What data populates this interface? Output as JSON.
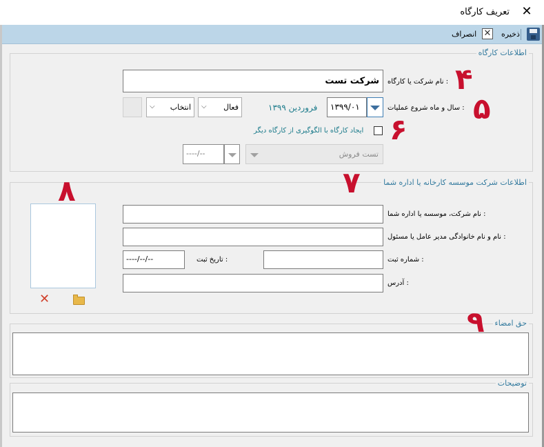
{
  "window": {
    "title": "تعریف کارگاه",
    "close_glyph": "✕"
  },
  "toolbar": {
    "save_label": "ذخیره",
    "cancel_label": "انصراف",
    "cancel_glyph": "✕"
  },
  "workshop_info": {
    "legend": "اطلاعات کارگاه",
    "company_label": "نام شرکت یا کارگاه :",
    "company_value": "شرکت تست",
    "start_label": "سال و ماه شروع عملیات :",
    "start_value": "۱۳۹۹/۰۱",
    "start_display": "فروردین ۱۳۹۹",
    "status_value": "فعال",
    "select_value": "انتخاب",
    "pattern_label": "ایجاد کارگاه با الگوگیری از کارگاه دیگر",
    "source_workshop_value": "تست فروش",
    "source_date_value": "----/--"
  },
  "company_info": {
    "legend": "اطلاعات شرکت موسسه کارخانه یا اداره شما",
    "name_label": "نام شرکت، موسسه یا اداره شما :",
    "manager_label": "نام و نام خانوادگی مدیر عامل یا مسئول :",
    "reg_number_label": "شماره ثبت :",
    "reg_date_label": "تاریخ ثبت :",
    "reg_date_value": "----/--/--",
    "address_label": "آدرس :"
  },
  "signature": {
    "legend": "حق امضاء"
  },
  "notes": {
    "legend": "توضیحات"
  },
  "image_actions": {
    "delete_glyph": "✕"
  },
  "annotations": [
    "۴",
    "۵",
    "۶",
    "۷",
    "۸",
    "۹"
  ],
  "colors": {
    "annotation": "#c8102e",
    "toolbar": "#bcd6e8",
    "legend": "#337a9e",
    "teal_text": "#1a7a8a"
  }
}
